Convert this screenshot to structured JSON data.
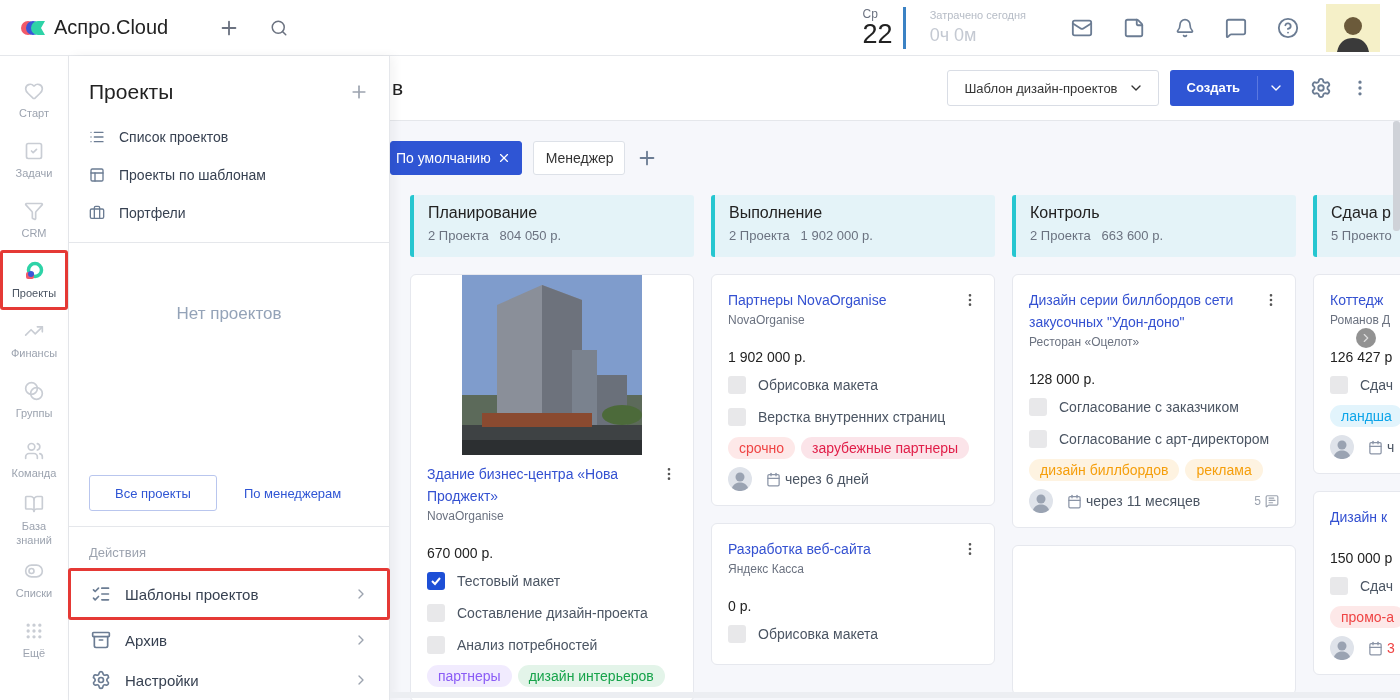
{
  "topbar": {
    "brand": "Аспро.Cloud",
    "day_of_week": "Ср",
    "day": "22",
    "time_label": "Затрачено сегодня",
    "time_value": "0ч 0м"
  },
  "rail": [
    {
      "label": "Старт",
      "selected": false,
      "highlighted": false
    },
    {
      "label": "Задачи",
      "selected": false,
      "highlighted": false
    },
    {
      "label": "CRM",
      "selected": false,
      "highlighted": false
    },
    {
      "label": "Проекты",
      "selected": true,
      "highlighted": true
    },
    {
      "label": "Финансы",
      "selected": false,
      "highlighted": false
    },
    {
      "label": "Группы",
      "selected": false,
      "highlighted": false
    },
    {
      "label": "Команда",
      "selected": false,
      "highlighted": false
    },
    {
      "label": "База знаний",
      "selected": false,
      "highlighted": false
    },
    {
      "label": "Списки",
      "selected": false,
      "highlighted": false
    },
    {
      "label": "Ещё",
      "selected": false,
      "highlighted": false
    }
  ],
  "panel": {
    "title": "Проекты",
    "menu": [
      "Список проектов",
      "Проекты по шаблонам",
      "Портфели"
    ],
    "empty_text": "Нет проектов",
    "buttons": [
      {
        "label": "Все проекты",
        "kind": "outline"
      },
      {
        "label": "По менеджерам",
        "kind": "link"
      }
    ],
    "section_label": "Действия",
    "actions": [
      {
        "label": "Шаблоны проектов",
        "highlighted": true
      },
      {
        "label": "Архив",
        "highlighted": false
      },
      {
        "label": "Настройки",
        "highlighted": false
      }
    ]
  },
  "page": {
    "title_fragment": "в",
    "template_select": "Шаблон дизайн-проектов",
    "create_button": "Создать"
  },
  "filters": [
    {
      "label": "По умолчанию",
      "selected": true
    },
    {
      "label": "Менеджер",
      "selected": false
    }
  ],
  "columns": [
    {
      "title": "Планирование",
      "count": "2 Проекта",
      "sum": "804 050 р.",
      "cards": [
        {
          "kind": "project",
          "cover": {
            "kind": "picture"
          },
          "title": "Здание бизнес-центра «Нова Проджект»",
          "client": "NovaOrganise",
          "amount": "670 000 р.",
          "tasks": [
            {
              "label": "Тестовый макет",
              "checked": true
            },
            {
              "label": "Составление дизайн-проекта",
              "checked": false
            },
            {
              "label": "Анализ потребностей",
              "checked": false
            }
          ],
          "tags": [
            {
              "label": "партнеры",
              "color": "#8b5cf6"
            },
            {
              "label": "дизайн интерьеров",
              "color": "#16a34a"
            }
          ]
        }
      ]
    },
    {
      "title": "Выполнение",
      "count": "2 Проекта",
      "sum": "1 902 000 р.",
      "cards": [
        {
          "kind": "project",
          "title": "Партнеры NovaOrganise",
          "client": "NovaOrganise",
          "amount": "1 902 000 р.",
          "tasks": [
            {
              "label": "Обрисовка макета",
              "checked": false
            },
            {
              "label": "Верстка внутренних страниц",
              "checked": false
            }
          ],
          "tags": [
            {
              "label": "срочно",
              "color": "#ef4444"
            },
            {
              "label": "зарубежные партнеры",
              "color": "#e11d48"
            }
          ],
          "footer": {
            "due": "через 6 дней",
            "overdue": false
          }
        },
        {
          "kind": "project",
          "title": "Разработка веб-сайта",
          "client": "Яндекс Касса",
          "amount": "0 р.",
          "tasks": [
            {
              "label": "Обрисовка макета",
              "checked": false
            }
          ]
        }
      ]
    },
    {
      "title": "Контроль",
      "count": "2 Проекта",
      "sum": "663 600 р.",
      "cards": [
        {
          "kind": "project",
          "title": "Дизайн серии биллбордов сети закусочных \"Удон-доно\"",
          "client": "Ресторан «Оцелот»",
          "amount": "128 000 р.",
          "tasks": [
            {
              "label": "Согласование с заказчиком",
              "checked": false
            },
            {
              "label": "Согласование с арт-директором",
              "checked": false
            }
          ],
          "tags": [
            {
              "label": "дизайн биллбордов",
              "color": "#f59e0b"
            },
            {
              "label": "реклама",
              "color": "#f59e0b"
            }
          ],
          "footer": {
            "due": "через 11 месяцев",
            "overdue": false,
            "comments": "5"
          }
        },
        {
          "kind": "blank"
        }
      ]
    },
    {
      "title": "Сдача р",
      "count": "5 Проекто",
      "cards": [
        {
          "kind": "project",
          "title": "Коттедж",
          "client": "Романов Д",
          "amount": "126 427 р",
          "tasks": [
            {
              "label": "Сдач",
              "checked": false
            }
          ],
          "tags": [
            {
              "label": "ландша",
              "color": "#0ea5e9"
            }
          ],
          "footer": {
            "due": "ч",
            "overdue": false
          }
        },
        {
          "kind": "project",
          "title": "Дизайн к",
          "amount": "150 000 р",
          "tasks": [
            {
              "label": "Сдач",
              "checked": false
            }
          ],
          "tags": [
            {
              "label": "промо-а",
              "color": "#ef4444"
            }
          ],
          "footer": {
            "due": "3",
            "overdue": true
          }
        }
      ]
    }
  ]
}
